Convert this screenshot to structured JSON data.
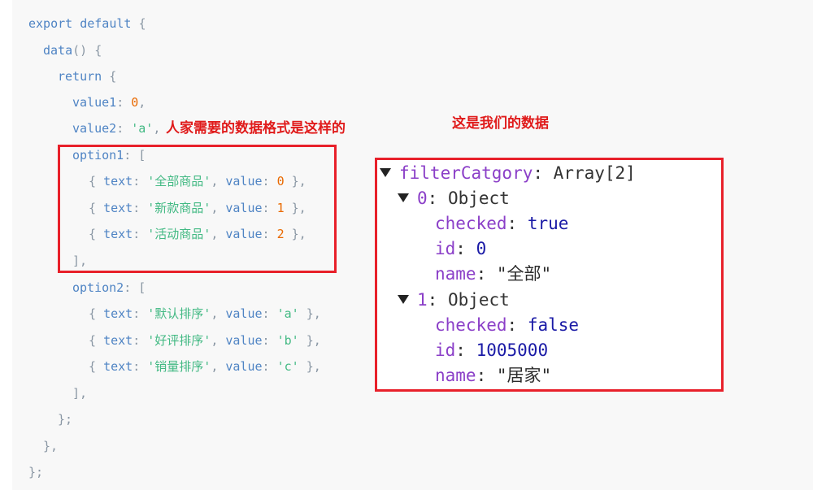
{
  "code": {
    "export": "export",
    "default": "default",
    "open_brace": " {",
    "data_fn": "data",
    "data_paren": "() {",
    "return_kw": "return",
    "return_brace": " {",
    "value1_key": "value1",
    "value1_sep": ": ",
    "value1_val": "0",
    "value1_end": ",",
    "value2_key": "value2",
    "value2_sep": ": ",
    "value2_val": "'a'",
    "value2_end": ",",
    "option1_key": "option1",
    "option2_key": "option2",
    "option_open": ": [",
    "option1_items": [
      {
        "text": "'全部商品'",
        "value": "0"
      },
      {
        "text": "'新款商品'",
        "value": "1"
      },
      {
        "text": "'活动商品'",
        "value": "2"
      }
    ],
    "option2_items": [
      {
        "text": "'默认排序'",
        "value": "'a'"
      },
      {
        "text": "'好评排序'",
        "value": "'b'"
      },
      {
        "text": "'销量排序'",
        "value": "'c'"
      }
    ],
    "item_open": "{ ",
    "text_key": "text",
    "value_key": "value",
    "colon": ": ",
    "comma": ", ",
    "item_close": " },",
    "array_close": "],",
    "return_close": "};",
    "fn_close": "},",
    "export_close": "};"
  },
  "annotations": {
    "needed_format": "人家需要的数据格式是这样的",
    "our_data": "这是我们的数据"
  },
  "devtools": {
    "root_key": "filterCatgory",
    "root_type": "Array[2]",
    "items": [
      {
        "index": "0",
        "type": "Object",
        "checked": "true",
        "id": "0",
        "name": "\"全部\""
      },
      {
        "index": "1",
        "type": "Object",
        "checked": "false",
        "id": "1005000",
        "name": "\"居家\""
      }
    ],
    "checked_key": "checked",
    "id_key": "id",
    "name_key": "name",
    "colon": ": "
  },
  "colors": {
    "annotation_red": "#e01b1b",
    "box_red": "#e8202a",
    "code_bg": "#f8f8f8",
    "keyword_blue": "#4f84c4",
    "string_green": "#42b983",
    "number_orange": "#e96900",
    "devtools_key_purple": "#8b3fc8"
  }
}
